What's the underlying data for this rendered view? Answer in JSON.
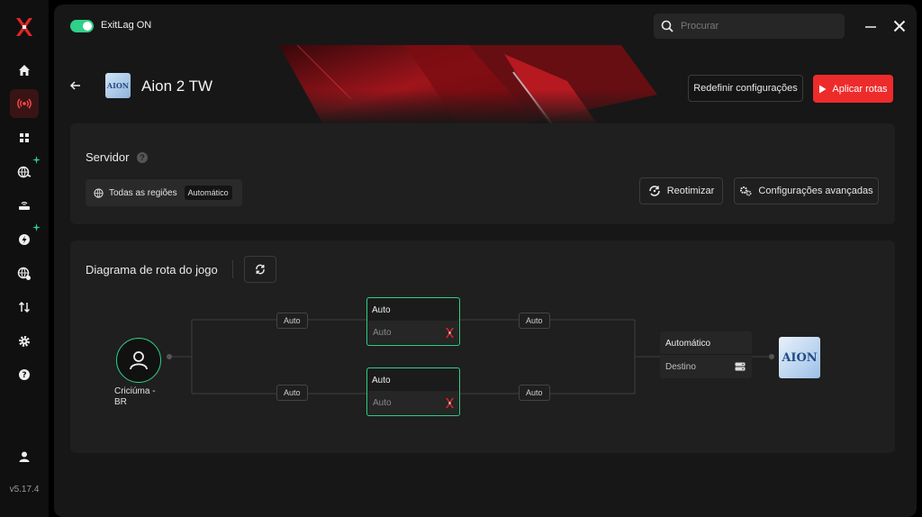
{
  "app": {
    "version": "v5.17.4"
  },
  "sidebar": {
    "items": [
      {
        "icon": "home-icon"
      },
      {
        "icon": "broadcast-icon",
        "active": true
      },
      {
        "icon": "apps-grid-icon"
      },
      {
        "icon": "globe-boost-icon",
        "badge": true
      },
      {
        "icon": "router-icon"
      },
      {
        "icon": "lightning-icon",
        "badge": true
      },
      {
        "icon": "world-network-icon"
      },
      {
        "icon": "transfer-arrows-icon"
      },
      {
        "icon": "settings-gear-icon"
      },
      {
        "icon": "help-icon"
      },
      {
        "icon": "user-profile-icon"
      }
    ]
  },
  "topbar": {
    "toggle_label": "ExitLag ON",
    "toggle_on": true,
    "search_placeholder": "Procurar"
  },
  "game": {
    "title": "Aion 2 TW",
    "thumb_text": "AION"
  },
  "header_actions": {
    "reset_label": "Redefinir configurações",
    "apply_label": "Aplicar rotas"
  },
  "server_panel": {
    "title": "Servidor",
    "region_label": "Todas as regiões",
    "region_mode": "Automático",
    "reoptimize_label": "Reotimizar",
    "advanced_label": "Configurações avançadas"
  },
  "diagram": {
    "title": "Diagrama de rota do jogo",
    "origin_label": "Criciúma - BR",
    "pills": [
      "Auto",
      "Auto",
      "Auto",
      "Auto"
    ],
    "nodes": [
      {
        "header": "Auto",
        "body": "Auto"
      },
      {
        "header": "Auto",
        "body": "Auto"
      }
    ],
    "destination": {
      "header": "Automático",
      "body": "Destino"
    },
    "game_thumb_text": "AION"
  },
  "colors": {
    "accent_green": "#2fd08a",
    "accent_red": "#ee2b2b"
  }
}
